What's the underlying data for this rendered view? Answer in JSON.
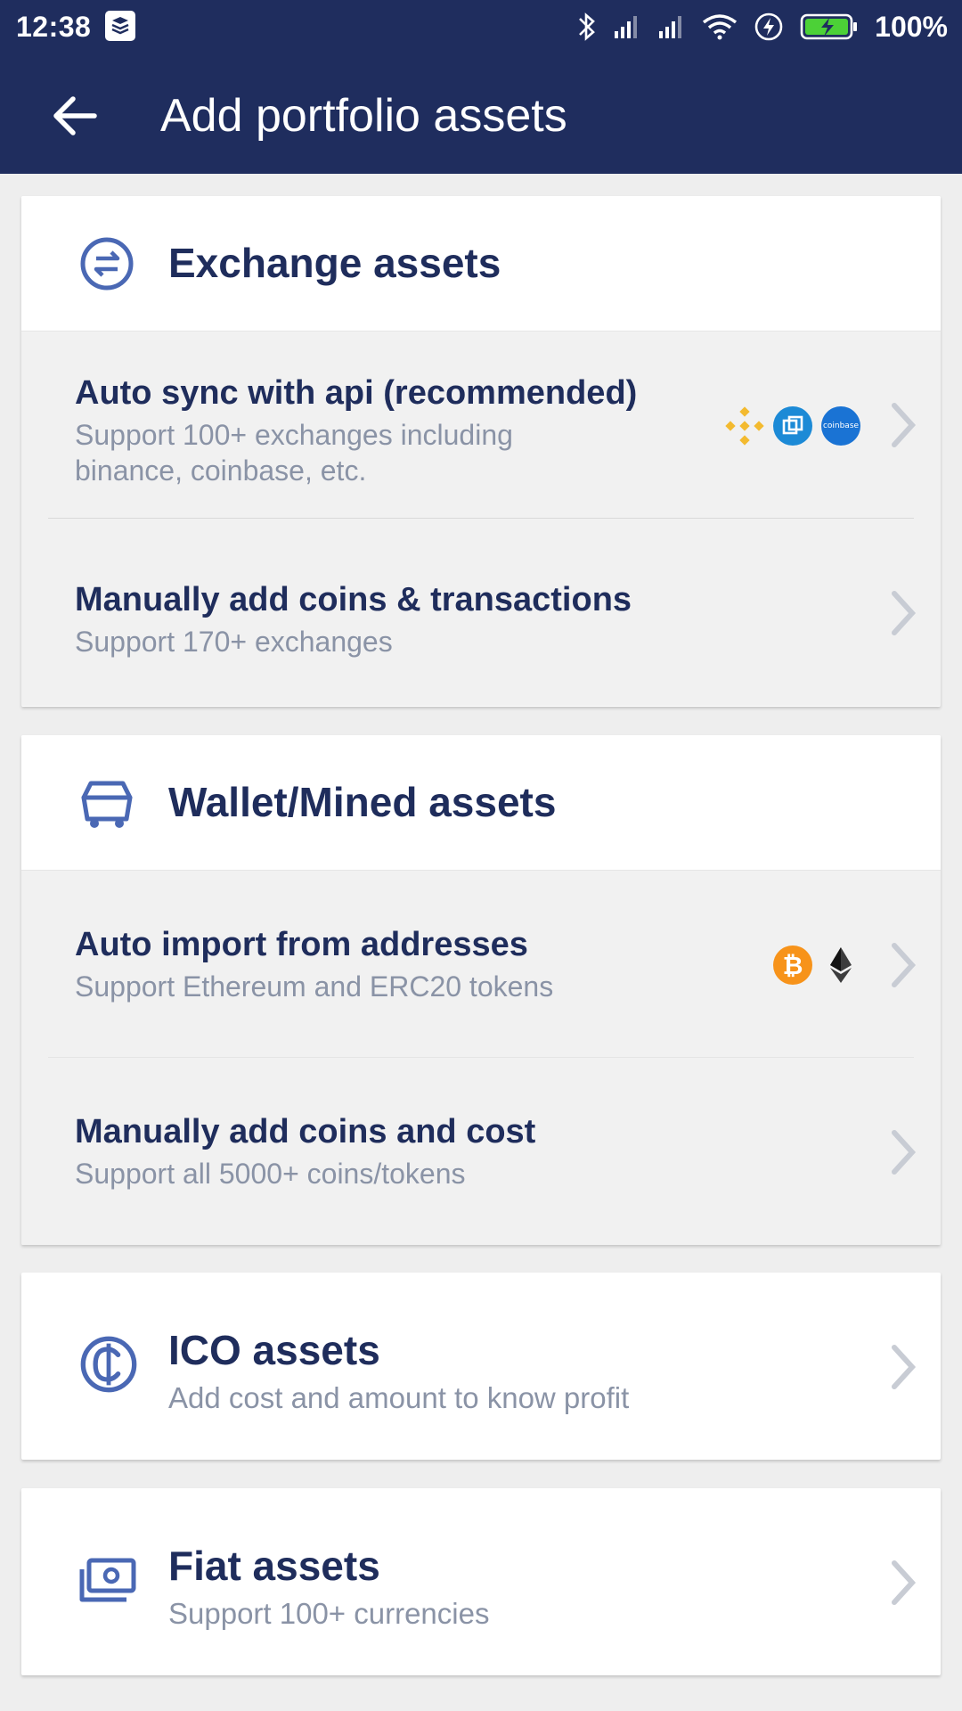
{
  "status_bar": {
    "time": "12:38",
    "battery_pct": "100%"
  },
  "toolbar": {
    "title": "Add portfolio assets"
  },
  "exchange": {
    "title": "Exchange assets",
    "auto_sync": {
      "title": "Auto sync with api (recommended)",
      "subtitle": "Support 100+ exchanges including binance, coinbase, etc.",
      "logos": [
        "binance-logo",
        "bittrex-logo",
        "coinbase-logo"
      ],
      "coinbase_text": "coinbase"
    },
    "manual": {
      "title": "Manually add coins & transactions",
      "subtitle": "Support 170+ exchanges"
    }
  },
  "wallet": {
    "title": "Wallet/Mined assets",
    "auto_import": {
      "title": "Auto import from addresses",
      "subtitle": "Support Ethereum and ERC20 tokens",
      "logos": [
        "bitcoin-logo",
        "ethereum-logo"
      ]
    },
    "manual": {
      "title": "Manually add coins and cost",
      "subtitle": "Support all 5000+ coins/tokens"
    }
  },
  "ico": {
    "title": "ICO assets",
    "subtitle": "Add cost and amount to know profit"
  },
  "fiat": {
    "title": "Fiat assets",
    "subtitle": "Support 100+ currencies"
  },
  "colors": {
    "appbar": "#1f2d5e",
    "primary_text": "#1f2d5c",
    "secondary_text": "#8a93a6",
    "icon_blue": "#4a68b4",
    "binance": "#f3ba2f",
    "bittrex": "#1c8ad6",
    "coinbase": "#1a73d4",
    "bitcoin": "#f7931a",
    "battery": "#4cd137"
  }
}
